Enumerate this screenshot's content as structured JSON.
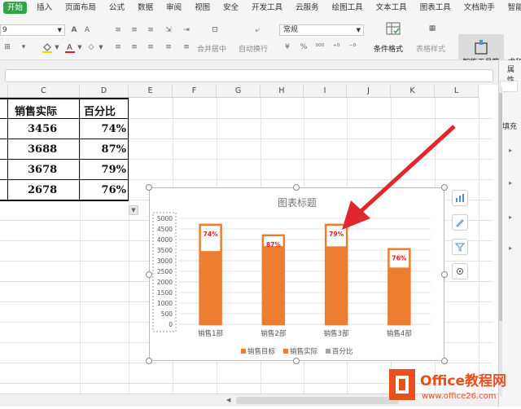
{
  "menubar": {
    "tabs": [
      "开始",
      "插入",
      "页面布局",
      "公式",
      "数据",
      "审阅",
      "视图",
      "安全",
      "开发工具",
      "云服务",
      "绘图工具",
      "文本工具",
      "图表工具",
      "文档助手",
      "智能工具"
    ]
  },
  "toolbar": {
    "font_size": "9",
    "number_format": "常规",
    "merge_center": "合并居中",
    "auto_wrap": "自动换行",
    "conditional_format": "条件格式",
    "table_style": "表格样式",
    "sum": "求和",
    "smart_toolbox": "智能工具箱"
  },
  "sheet": {
    "columns": [
      "C",
      "D",
      "E",
      "F",
      "G",
      "H",
      "I",
      "J",
      "K",
      "L"
    ],
    "headers": [
      "销售实际",
      "百分比"
    ],
    "rows": [
      {
        "actual": "3456",
        "pct": "74%"
      },
      {
        "actual": "3688",
        "pct": "87%"
      },
      {
        "actual": "3678",
        "pct": "79%"
      },
      {
        "actual": "2678",
        "pct": "76%"
      }
    ]
  },
  "right_pane": {
    "title": "属性",
    "items": [
      "填充"
    ]
  },
  "chart_data": {
    "type": "bar",
    "title": "图表标题",
    "categories": [
      "销售1部",
      "销售2部",
      "销售3部",
      "销售4部"
    ],
    "series": [
      {
        "name": "销售目标",
        "values": [
          4700,
          4200,
          4700,
          3550
        ],
        "color": "#ed7d31"
      },
      {
        "name": "销售实际",
        "values": [
          3456,
          3688,
          3678,
          2678
        ],
        "color": "#ed7d31"
      },
      {
        "name": "百分比",
        "values": [
          0.74,
          0.87,
          0.79,
          0.76
        ],
        "color": "#a5a5a5"
      }
    ],
    "data_labels": [
      "74%",
      "87%",
      "79%",
      "76%"
    ],
    "yticks": [
      "0",
      "500",
      "1000",
      "1500",
      "2000",
      "2500",
      "3000",
      "3500",
      "4000",
      "4500",
      "5000"
    ],
    "ylim": [
      0,
      5000
    ],
    "grid": true,
    "legend": "bottom"
  },
  "watermark": {
    "brand": "Office教程网",
    "url": "www.office26.com"
  }
}
